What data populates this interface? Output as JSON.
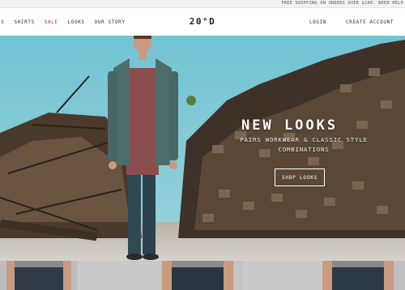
{
  "announcement": "FREE SHIPPING ON ORDERS OVER $100. NEED HELP",
  "nav": {
    "left": [
      "CS",
      "SHIRTS",
      "SALE",
      "LOOKS",
      "OUR STORY"
    ],
    "logo": "20°D",
    "login": "LOGIN",
    "create_account": "CREATE ACCOUNT"
  },
  "hero": {
    "title": "NEW LOOKS",
    "subtitle": "PAIRS WORKWEAR & CLASSIC STYLE COMBINATIONS",
    "button": "SHOP LOOKS"
  },
  "colors": {
    "accent_sale": "#c0392b",
    "sky": "#7ec7d6",
    "denim": "#2f4a55"
  }
}
